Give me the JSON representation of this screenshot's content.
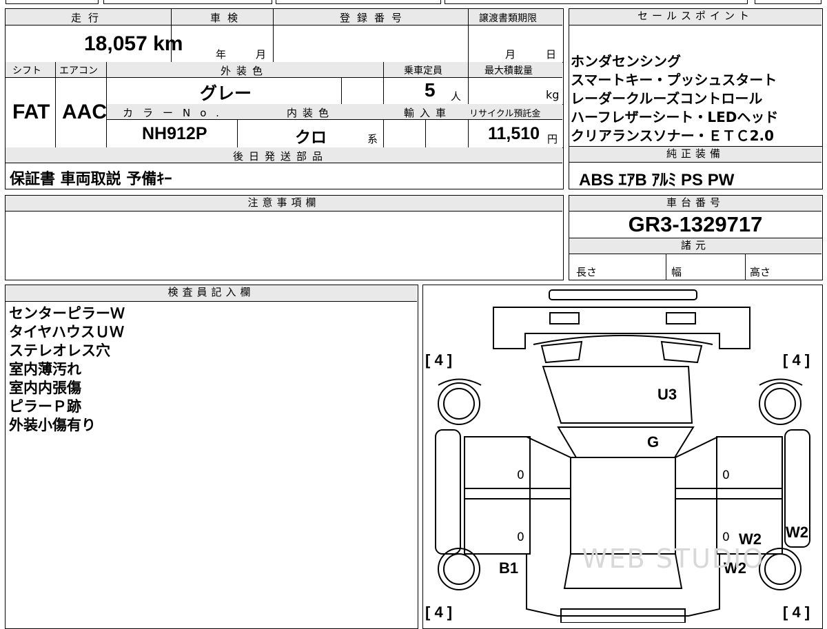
{
  "top_fragment": "",
  "mileage": {
    "label": "走行",
    "value": "18,057",
    "unit": "km"
  },
  "inspection": {
    "label": "車検",
    "year": "年",
    "month": "月"
  },
  "registration": {
    "label": "登録番号"
  },
  "transfer": {
    "label": "譲渡書類期限",
    "month": "月",
    "day": "日"
  },
  "shift": {
    "label": "シフト",
    "value": "FAT"
  },
  "aircon": {
    "label": "エアコン",
    "value": "AAC"
  },
  "exterior_color": {
    "label": "外装色",
    "value": "グレー"
  },
  "capacity": {
    "label": "乗車定員",
    "value": "5",
    "unit": "人"
  },
  "max_load": {
    "label": "最大積載量",
    "unit": "kg"
  },
  "color_no": {
    "label": "カラーNo.",
    "value": "NH912P"
  },
  "interior_color": {
    "label": "内装色",
    "value": "クロ",
    "suffix": "系"
  },
  "import": {
    "label": "輸入車"
  },
  "recycle": {
    "label": "リサイクル預託金",
    "value": "11,510",
    "unit": "円"
  },
  "later_parts": {
    "label": "後日発送部品",
    "value": "保証書 車両取説 予備ｷｰ"
  },
  "sales_points": {
    "label": "セールスポイント",
    "lines": [
      "ホンダセンシング",
      "スマートキー・プッシュスタート",
      "レーダークルーズコントロール",
      "ハーフレザーシート・LEDヘッド",
      "クリアランスソナー・ＥＴＣ2.0"
    ]
  },
  "equipment": {
    "label": "純正装備",
    "value": "ABS ｴｱB ｱﾙﾐ PS PW"
  },
  "notes": {
    "label": "注意事項欄"
  },
  "chassis": {
    "label": "車台番号",
    "value": "GR3-1329717"
  },
  "specs": {
    "label": "諸元",
    "length": "長さ",
    "width": "幅",
    "height": "高さ"
  },
  "inspector": {
    "label": "検査員記入欄",
    "lines": [
      "センターピラーＷ",
      "タイヤハウスＵＷ",
      "ステレオレス穴",
      "室内薄汚れ",
      "室内内張傷",
      "ピラーＰ跡",
      "外装小傷有り"
    ]
  },
  "diagram": {
    "tire_tl": "[ 4 ]",
    "tire_tr": "[ 4 ]",
    "tire_bl": "[ 4 ]",
    "tire_br": "[ 4 ]",
    "hood": "U3",
    "windshield": "G",
    "seat_lf": "0",
    "seat_lr": "0",
    "seat_rf": "0",
    "seat_rr": "0",
    "rr_door": "W2",
    "right_side": "W2",
    "rr_fender": "W2",
    "lr_fender": "B1",
    "watermark": "WEB STUDIO"
  }
}
